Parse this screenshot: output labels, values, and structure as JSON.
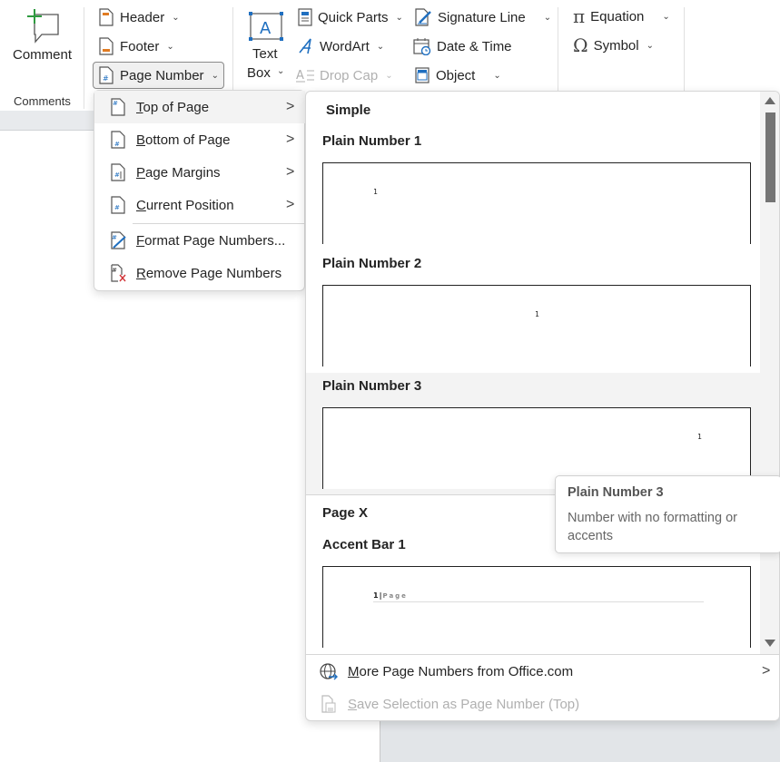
{
  "ribbon": {
    "comment_label": "Comment",
    "comments_group_label": "Comments",
    "header_label": "Header",
    "footer_label": "Footer",
    "page_number_label": "Page Number",
    "text_box_label_line1": "Text",
    "text_box_label_line2": "Box",
    "quick_parts_label": "Quick Parts",
    "wordart_label": "WordArt",
    "drop_cap_label": "Drop Cap",
    "signature_line_label": "Signature Line",
    "date_time_label": "Date & Time",
    "object_label": "Object",
    "equation_label": "Equation",
    "symbol_label": "Symbol"
  },
  "page_number_menu": {
    "items": [
      {
        "accel": "T",
        "rest": "op of Page",
        "has_submenu": true,
        "icon": "page-number-top-icon"
      },
      {
        "accel": "B",
        "rest": "ottom of Page",
        "has_submenu": true,
        "icon": "page-number-bottom-icon"
      },
      {
        "accel": "P",
        "rest": "age Margins",
        "has_submenu": true,
        "icon": "page-number-margins-icon"
      },
      {
        "accel": "C",
        "rest": "urrent Position",
        "has_submenu": true,
        "icon": "page-number-current-icon"
      },
      {
        "accel": "F",
        "rest": "ormat Page Numbers...",
        "has_submenu": false,
        "icon": "format-page-numbers-icon"
      },
      {
        "accel": "R",
        "rest": "emove Page Numbers",
        "has_submenu": false,
        "icon": "remove-page-numbers-icon"
      }
    ],
    "submenu_arrow": ">"
  },
  "gallery": {
    "section_simple": "Simple",
    "section_page_x": "Page X",
    "items": [
      {
        "title": "Plain Number 1",
        "preview": "1"
      },
      {
        "title": "Plain Number 2",
        "preview": "1"
      },
      {
        "title": "Plain Number 3",
        "preview": "1"
      },
      {
        "title": "Accent Bar 1",
        "preview_num": "1",
        "preview_sep": "|",
        "preview_text": "Page"
      }
    ],
    "footer": {
      "more_accel": "M",
      "more_rest": "ore Page Numbers from Office.com",
      "save_accel": "S",
      "save_rest": "ave Selection as Page Number (Top)",
      "arrow": ">"
    }
  },
  "tooltip": {
    "title": "Plain Number 3",
    "body": "Number with no formatting or accents"
  }
}
